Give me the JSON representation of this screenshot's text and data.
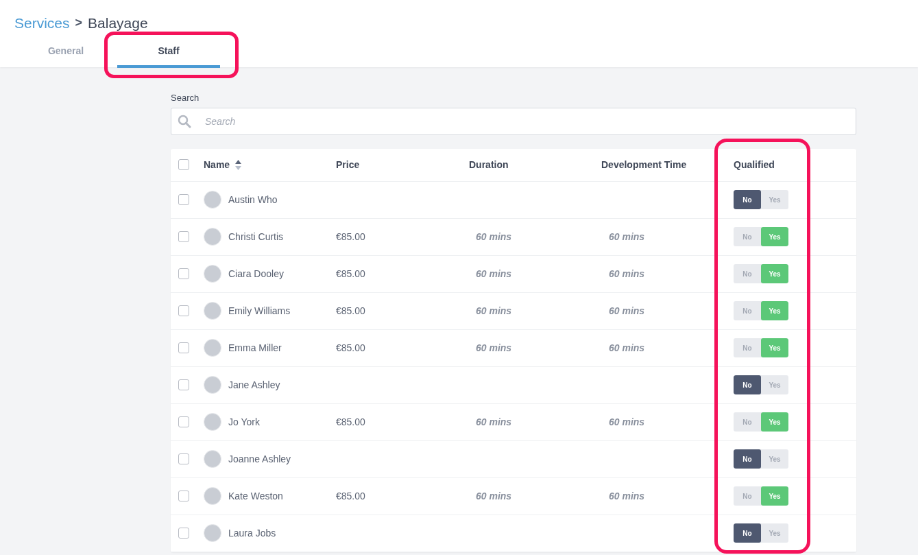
{
  "breadcrumb": {
    "parent": "Services",
    "separator": ">",
    "current": "Balayage"
  },
  "tabs": [
    {
      "label": "General",
      "selected": false
    },
    {
      "label": "Staff",
      "selected": true
    }
  ],
  "search": {
    "label": "Search",
    "placeholder": "Search"
  },
  "table": {
    "columns": [
      "Name",
      "Price",
      "Duration",
      "Development Time",
      "Qualified"
    ],
    "select_all_checked": false,
    "rows": [
      {
        "name": "Austin Who",
        "checked": false,
        "qualified": false,
        "no_label": "No",
        "yes_label": "Yes"
      },
      {
        "name": "Christi Curtis",
        "checked": false,
        "price": "€85.00",
        "duration": "60 mins",
        "development_time": "60 mins",
        "qualified": true,
        "no_label": "No",
        "yes_label": "Yes"
      },
      {
        "name": "Ciara Dooley",
        "checked": false,
        "price": "€85.00",
        "duration": "60 mins",
        "development_time": "60 mins",
        "qualified": true,
        "no_label": "No",
        "yes_label": "Yes"
      },
      {
        "name": "Emily Williams",
        "checked": false,
        "price": "€85.00",
        "duration": "60 mins",
        "development_time": "60 mins",
        "qualified": true,
        "no_label": "No",
        "yes_label": "Yes"
      },
      {
        "name": "Emma Miller",
        "checked": false,
        "price": "€85.00",
        "duration": "60 mins",
        "development_time": "60 mins",
        "qualified": true,
        "no_label": "No",
        "yes_label": "Yes"
      },
      {
        "name": "Jane Ashley",
        "checked": false,
        "qualified": false,
        "no_label": "No",
        "yes_label": "Yes"
      },
      {
        "name": "Jo York",
        "checked": false,
        "price": "€85.00",
        "duration": "60 mins",
        "development_time": "60 mins",
        "qualified": true,
        "no_label": "No",
        "yes_label": "Yes"
      },
      {
        "name": "Joanne Ashley",
        "checked": false,
        "qualified": false,
        "no_label": "No",
        "yes_label": "Yes"
      },
      {
        "name": "Kate Weston",
        "checked": false,
        "price": "€85.00",
        "duration": "60 mins",
        "development_time": "60 mins",
        "qualified": true,
        "no_label": "No",
        "yes_label": "Yes"
      },
      {
        "name": "Laura Jobs",
        "checked": false,
        "qualified": false,
        "no_label": "No",
        "yes_label": "Yes"
      }
    ]
  }
}
